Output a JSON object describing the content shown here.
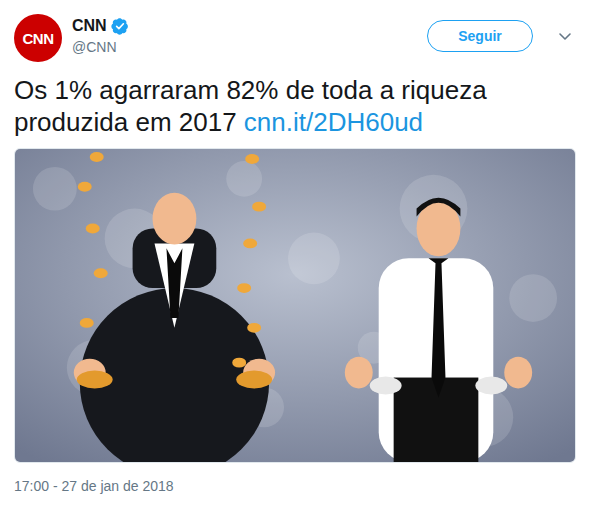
{
  "tweet": {
    "avatar_logo": "CNN",
    "author": {
      "name": "CNN",
      "handle": "@CNN",
      "verified": true
    },
    "follow_button": "Seguir",
    "text": "Os 1% agarraram 82% de toda a riqueza produzida em 2017",
    "link": "cnn.it/2DH60ud",
    "timestamp": "17:00 - 27 de jan de 2018"
  }
}
